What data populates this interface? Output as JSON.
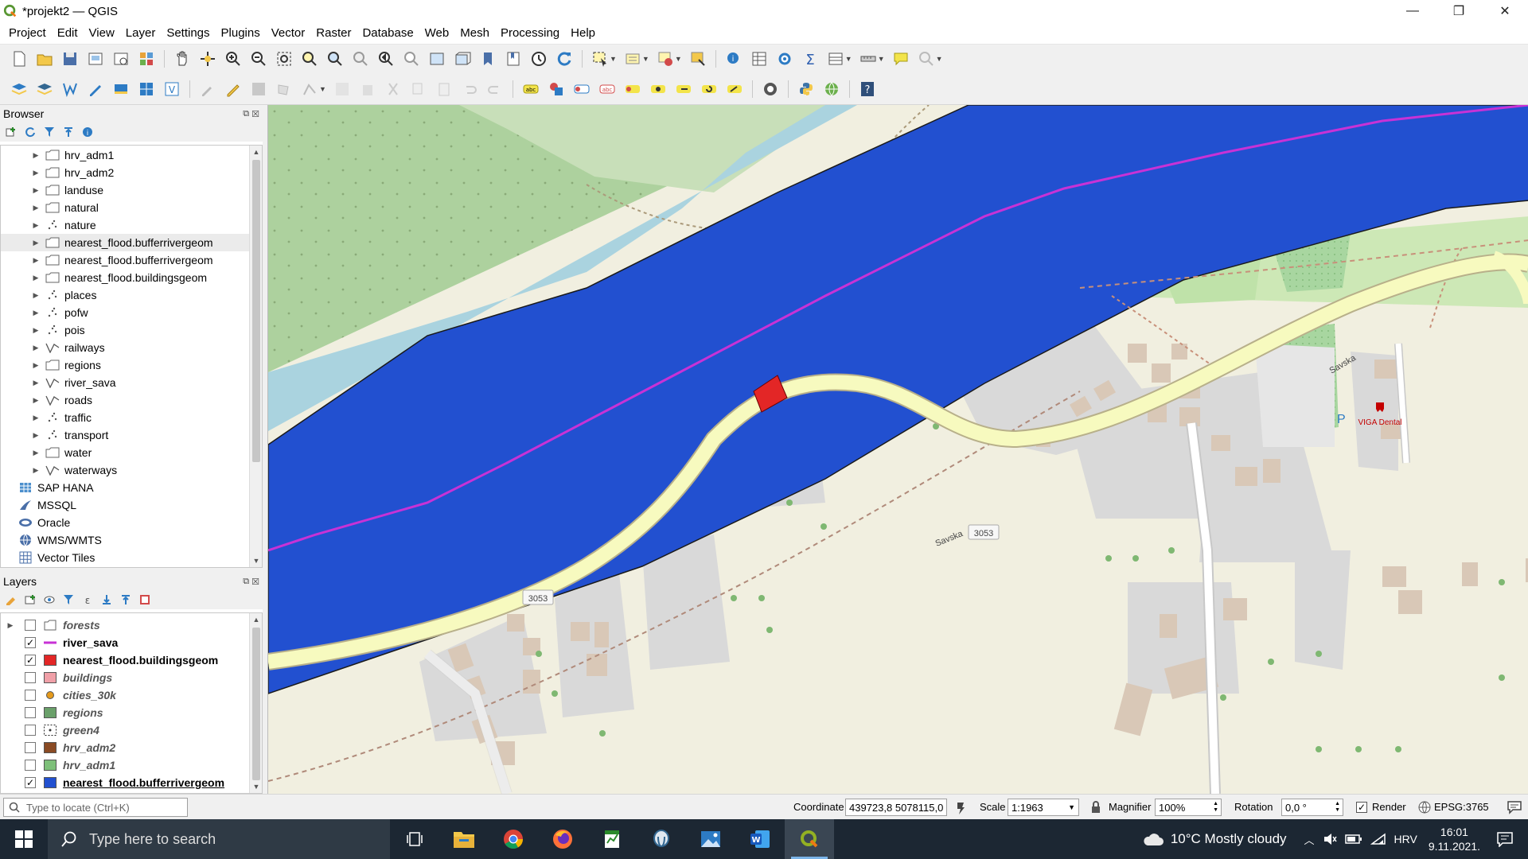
{
  "window": {
    "title": "*projekt2 — QGIS",
    "min": "—",
    "max": "❐",
    "close": "✕"
  },
  "menubar": [
    "Project",
    "Edit",
    "View",
    "Layer",
    "Settings",
    "Plugins",
    "Vector",
    "Raster",
    "Database",
    "Web",
    "Mesh",
    "Processing",
    "Help"
  ],
  "browser": {
    "title": "Browser",
    "items": [
      {
        "label": "hrv_adm1",
        "icon": "polygon-icon",
        "expand": true
      },
      {
        "label": "hrv_adm2",
        "icon": "polygon-icon",
        "expand": true
      },
      {
        "label": "landuse",
        "icon": "polygon-icon",
        "expand": true
      },
      {
        "label": "natural",
        "icon": "polygon-icon",
        "expand": true
      },
      {
        "label": "nature",
        "icon": "point-icon",
        "expand": true
      },
      {
        "label": "nearest_flood.bufferrivergeom",
        "icon": "polygon-icon",
        "expand": true,
        "highlight": true
      },
      {
        "label": "nearest_flood.bufferrivergeom",
        "icon": "polygon-icon",
        "expand": true
      },
      {
        "label": "nearest_flood.buildingsgeom",
        "icon": "polygon-icon",
        "expand": true
      },
      {
        "label": "places",
        "icon": "point-icon",
        "expand": true
      },
      {
        "label": "pofw",
        "icon": "point-icon",
        "expand": true
      },
      {
        "label": "pois",
        "icon": "point-icon",
        "expand": true
      },
      {
        "label": "railways",
        "icon": "line-icon",
        "expand": true
      },
      {
        "label": "regions",
        "icon": "polygon-icon",
        "expand": true
      },
      {
        "label": "river_sava",
        "icon": "line-icon",
        "expand": true
      },
      {
        "label": "roads",
        "icon": "line-icon",
        "expand": true
      },
      {
        "label": "traffic",
        "icon": "point-icon",
        "expand": true
      },
      {
        "label": "transport",
        "icon": "point-icon",
        "expand": true
      },
      {
        "label": "water",
        "icon": "polygon-icon",
        "expand": true
      },
      {
        "label": "waterways",
        "icon": "line-icon",
        "expand": true
      },
      {
        "label": "SAP HANA",
        "icon": "sap-hana-icon",
        "expand": false
      },
      {
        "label": "MSSQL",
        "icon": "mssql-icon",
        "expand": false
      },
      {
        "label": "Oracle",
        "icon": "oracle-icon",
        "expand": false
      },
      {
        "label": "WMS/WMTS",
        "icon": "wms-icon",
        "expand": false
      },
      {
        "label": "Vector Tiles",
        "icon": "vector-tiles-icon",
        "expand": false
      }
    ]
  },
  "layers": {
    "title": "Layers",
    "items": [
      {
        "label": "forests",
        "checked": false,
        "symbol": "group",
        "group": true
      },
      {
        "label": "river_sava",
        "checked": true,
        "symbol": "line",
        "color": "#c832d6"
      },
      {
        "label": "nearest_flood.buildingsgeom",
        "checked": true,
        "symbol": "fill",
        "color": "#e32626"
      },
      {
        "label": "buildings",
        "checked": false,
        "symbol": "fill",
        "color": "#f0a0a8"
      },
      {
        "label": "cities_30k",
        "checked": false,
        "symbol": "point",
        "color": "#e59a1c"
      },
      {
        "label": "regions",
        "checked": false,
        "symbol": "fill",
        "color": "#6aa06a"
      },
      {
        "label": "green4",
        "checked": false,
        "symbol": "dots",
        "color": "#ffffff"
      },
      {
        "label": "hrv_adm2",
        "checked": false,
        "symbol": "fill",
        "color": "#8a4b24"
      },
      {
        "label": "hrv_adm1",
        "checked": false,
        "symbol": "fill",
        "color": "#7ec07a"
      },
      {
        "label": "nearest_flood.bufferrivergeom",
        "checked": true,
        "symbol": "fill",
        "color": "#2250d0",
        "underline": true
      }
    ]
  },
  "map": {
    "labels": {
      "road_name_1": "Savska",
      "road_name_2": "Savska",
      "road_ref_1": "3053",
      "road_ref_2": "3053",
      "parking": "P",
      "poi": "VIGA Dental"
    },
    "colors": {
      "buffer": "#2250d0",
      "river_line": "#c832d6",
      "building_hl": "#e32626",
      "forest": "#add19e",
      "road": "#f7fabf"
    }
  },
  "statusbar": {
    "locate_placeholder": "Type to locate (Ctrl+K)",
    "coordinate_label": "Coordinate",
    "coordinate_value": "439723,8 5078115,0",
    "scale_label": "Scale",
    "scale_value": "1:1963",
    "magnifier_label": "Magnifier",
    "magnifier_value": "100%",
    "rotation_label": "Rotation",
    "rotation_value": "0,0 °",
    "render_label": "Render",
    "crs": "EPSG:3765"
  },
  "taskbar": {
    "search_placeholder": "Type here to search",
    "weather": "10°C  Mostly cloudy",
    "language": "HRV",
    "time": "16:01",
    "date": "9.11.2021."
  }
}
